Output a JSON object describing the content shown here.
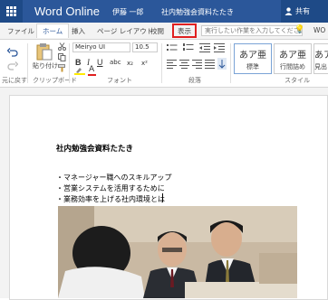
{
  "titlebar": {
    "app_name": "Word Online",
    "user_name": "伊藤 一郎",
    "document_title": "社内勉強会資料たたき",
    "share_label": "共有"
  },
  "tabs": [
    "ファイル",
    "ホーム",
    "挿入",
    "ページ レイアウト",
    "校閲",
    "表示"
  ],
  "tell_me": {
    "placeholder": "実行したい作業を入力してください"
  },
  "overflow_tab": "WO",
  "ribbon": {
    "undo_group": "元に戻す",
    "clipboard": {
      "paste_label": "貼り付け",
      "group": "クリップボード"
    },
    "font": {
      "name": "Meiryo UI",
      "size": "10.5",
      "group": "フォント"
    },
    "paragraph": {
      "group": "段落"
    },
    "styles": {
      "group": "スタイル",
      "items": [
        {
          "sample": "あア亜",
          "label": "標準"
        },
        {
          "sample": "あア亜",
          "label": "行間詰め"
        },
        {
          "sample": "あア亜",
          "label": "見出"
        }
      ]
    }
  },
  "document": {
    "heading": "社内勉強会資料たたき",
    "bullets": [
      "・マネージャー職へのスキルアップ",
      "・営業システムを活用するために",
      "・業務効率を上げる社内環境とは"
    ]
  },
  "colors": {
    "titlebar": "#2b579a",
    "highlight": "#e02020"
  }
}
